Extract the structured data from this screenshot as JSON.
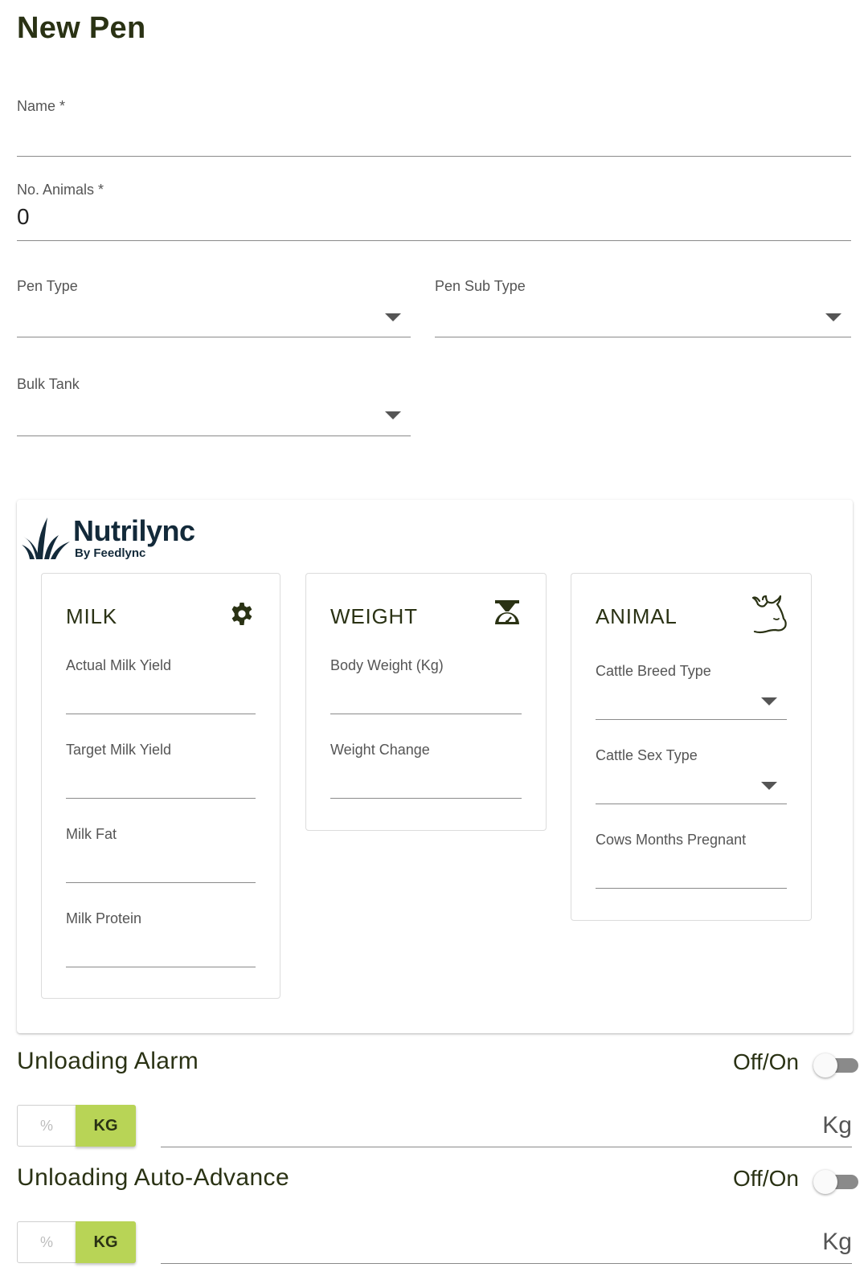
{
  "page": {
    "title": "New Pen"
  },
  "form": {
    "name": {
      "label": "Name *",
      "value": ""
    },
    "animals": {
      "label": "No. Animals *",
      "value": "0"
    },
    "pen_type": {
      "label": "Pen Type",
      "value": ""
    },
    "pen_sub_type": {
      "label": "Pen Sub Type",
      "value": ""
    },
    "bulk_tank": {
      "label": "Bulk Tank",
      "value": ""
    }
  },
  "nutrilync": {
    "brand": "Nutrilync",
    "byline": "By Feedlync",
    "milk": {
      "title": "MILK",
      "icon": "gear-icon",
      "fields": [
        "Actual Milk Yield",
        "Target Milk Yield",
        "Milk Fat",
        "Milk Protein"
      ]
    },
    "weight": {
      "title": "WEIGHT",
      "icon": "scale-icon",
      "fields": [
        "Body Weight (Kg)",
        "Weight Change"
      ]
    },
    "animal": {
      "title": "ANIMAL",
      "icon": "cow-icon",
      "fields": [
        "Cattle Breed Type",
        "Cattle Sex Type",
        "Cows Months Pregnant"
      ]
    }
  },
  "unloading_alarm": {
    "title": "Unloading Alarm",
    "toggle_label": "Off/On",
    "enabled": false,
    "unit_percent": "%",
    "unit_kg": "KG",
    "selected_unit": "KG",
    "suffix": "Kg",
    "value": ""
  },
  "unloading_auto_advance": {
    "title": "Unloading Auto-Advance",
    "toggle_label": "Off/On",
    "enabled": false,
    "unit_percent": "%",
    "unit_kg": "KG",
    "selected_unit": "KG",
    "suffix": "Kg",
    "value": ""
  },
  "colors": {
    "accent": "#b8d456",
    "title": "#2a3214",
    "brand": "#132a3a"
  }
}
